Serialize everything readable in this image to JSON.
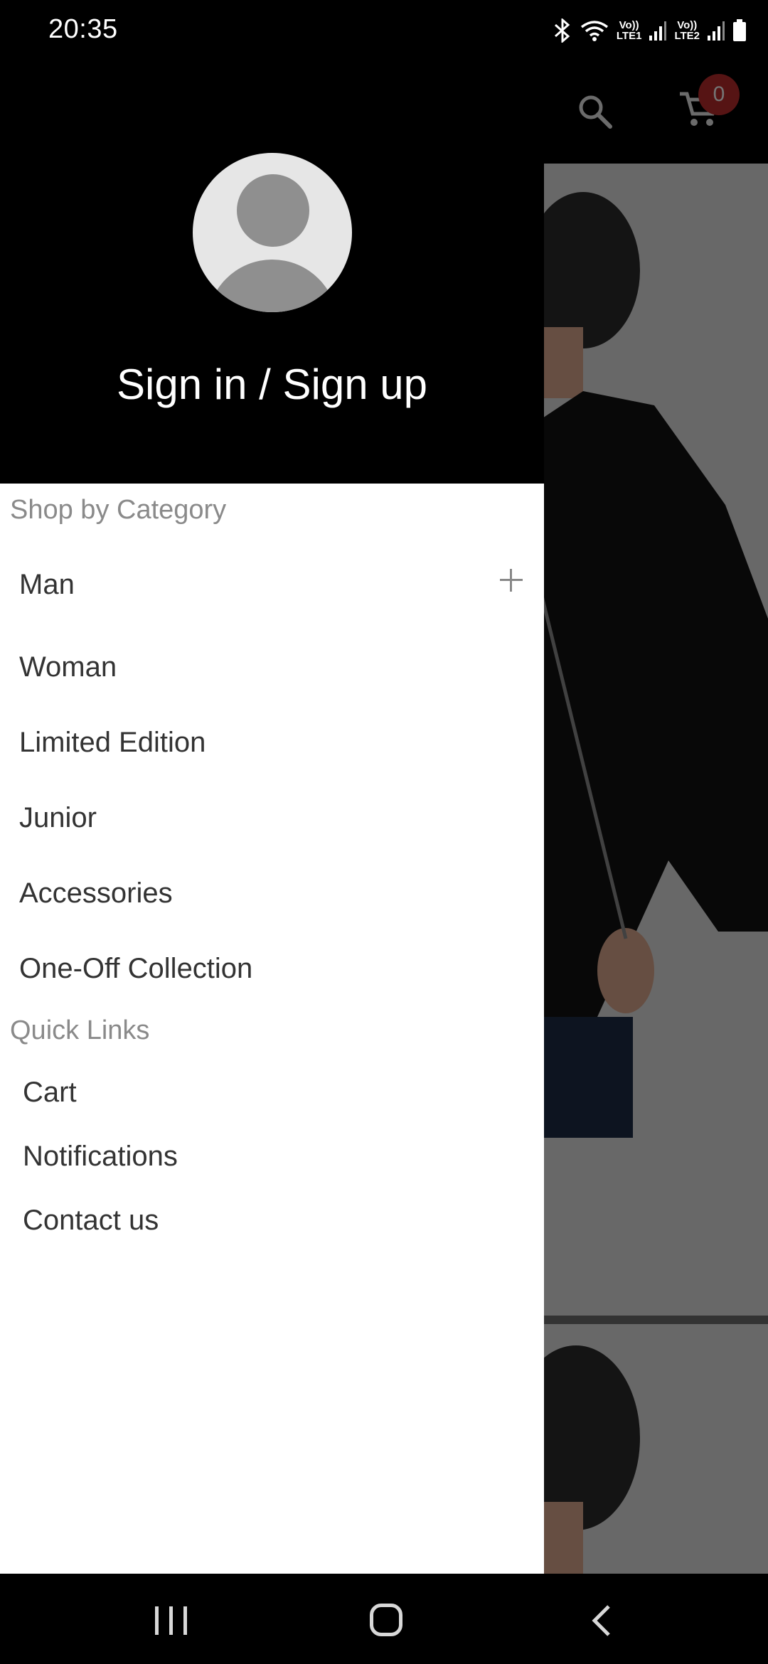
{
  "status_bar": {
    "time": "20:35",
    "sim1_label_top": "Vo))",
    "sim1_label_bottom": "LTE1",
    "sim2_label_top": "Vo))",
    "sim2_label_bottom": "LTE2",
    "icons": [
      "bluetooth-icon",
      "wifi-icon",
      "signal-icon",
      "signal-icon",
      "battery-icon"
    ]
  },
  "app_header": {
    "icons": [
      "search-icon",
      "cart-icon"
    ],
    "cart_count": "0",
    "badge_color": "#b52a2a"
  },
  "drawer": {
    "sign_in_label": "Sign in / Sign up",
    "category_section_title": "Shop by Category",
    "categories": [
      {
        "label": "Man",
        "expandable": true
      },
      {
        "label": "Woman"
      },
      {
        "label": "Limited Edition"
      },
      {
        "label": "Junior"
      },
      {
        "label": "Accessories"
      },
      {
        "label": "One-Off Collection"
      }
    ],
    "quick_links_title": "Quick Links",
    "quick_links": [
      {
        "label": "Cart"
      },
      {
        "label": "Notifications"
      },
      {
        "label": "Contact us"
      }
    ]
  },
  "nav_bar": {
    "icons": [
      "recent-apps-icon",
      "home-icon",
      "back-icon"
    ]
  }
}
